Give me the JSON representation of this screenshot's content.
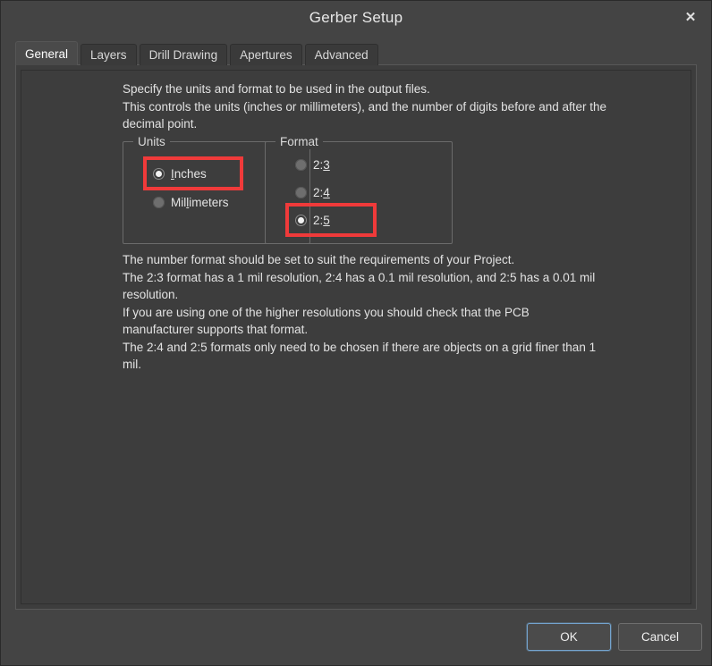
{
  "window": {
    "title": "Gerber Setup",
    "close_label": "✕",
    "close_icon": "close-icon"
  },
  "tabs": [
    {
      "label": "General",
      "active": true
    },
    {
      "label": "Layers",
      "active": false
    },
    {
      "label": "Drill Drawing",
      "active": false
    },
    {
      "label": "Apertures",
      "active": false
    },
    {
      "label": "Advanced",
      "active": false
    }
  ],
  "content": {
    "intro_text": "Specify the units and format to be used in the output files.\nThis controls the units (inches or millimeters), and the number of digits before and after the decimal point.",
    "detail_text": "The number format should be set to suit the requirements of your Project.\nThe 2:3 format has a 1 mil resolution, 2:4 has a 0.1 mil resolution, and 2:5 has a 0.01 mil resolution.\nIf you are using one of the higher resolutions you should check that the PCB manufacturer supports that format.\nThe 2:4 and 2:5 formats only need to be chosen if there are objects on a grid finer than 1 mil."
  },
  "units_group": {
    "legend": "Units",
    "options": [
      {
        "label": "Inches",
        "accel_index": 0,
        "checked": true,
        "highlighted": true
      },
      {
        "label": "Millimeters",
        "accel_index": 3,
        "checked": false,
        "highlighted": false
      }
    ]
  },
  "format_group": {
    "legend": "Format",
    "options": [
      {
        "label": "2:3",
        "accel_index": 2,
        "checked": false,
        "highlighted": false
      },
      {
        "label": "2:4",
        "accel_index": 2,
        "checked": false,
        "highlighted": false
      },
      {
        "label": "2:5",
        "accel_index": 2,
        "checked": true,
        "highlighted": true
      }
    ]
  },
  "footer": {
    "ok_label": "OK",
    "cancel_label": "Cancel"
  },
  "colors": {
    "window_bg": "#444444",
    "page_bg": "#3d3d3d",
    "tab_active_bg": "#4a4a4a",
    "text": "#e2e2e2",
    "highlight_red": "#f03a3a",
    "default_button_border": "#74a4cf"
  }
}
